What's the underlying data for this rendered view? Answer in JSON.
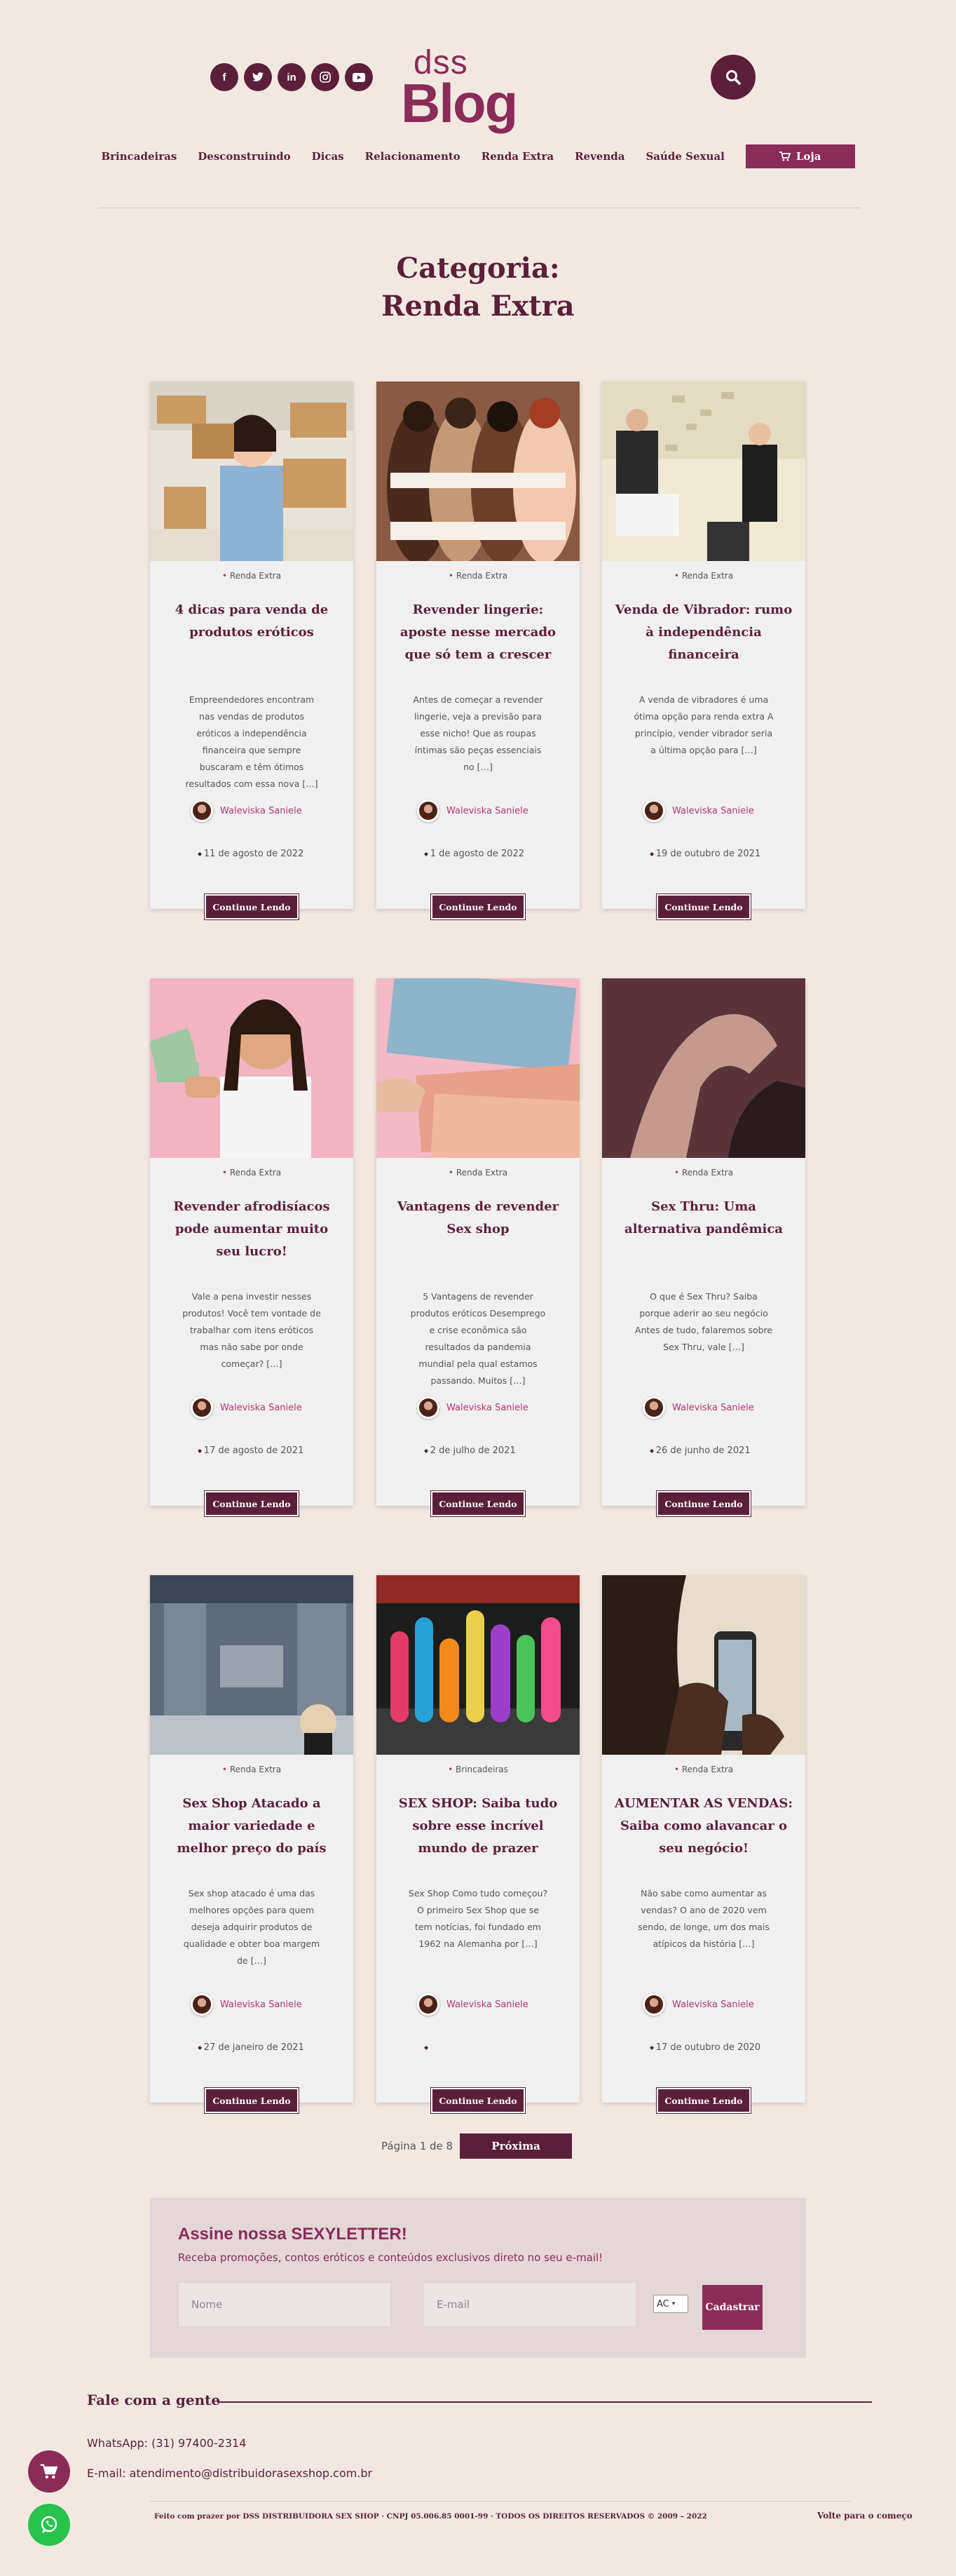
{
  "header": {
    "logo_small": "dss",
    "logo_big": "Blog",
    "socials": [
      "f",
      "t",
      "in",
      "ig",
      "yt"
    ],
    "nav": [
      "Brincadeiras",
      "Desconstruindo",
      "Dicas",
      "Relacionamento",
      "Renda Extra",
      "Revenda",
      "Saúde Sexual"
    ],
    "shop_label": "Loja"
  },
  "category": {
    "line1": "Categoria:",
    "line2": "Renda Extra"
  },
  "cards": [
    {
      "category": "Renda Extra",
      "title": "4 dicas para venda de produtos eróticos",
      "excerpt": "Empreendedores encontram nas vendas de produtos eróticos a independência financeira que sempre buscaram e têm ótimos resultados com essa nova […]",
      "author": "Waleviska Saniele",
      "date": "11 de agosto de 2022",
      "more": "Continue Lendo"
    },
    {
      "category": "Renda Extra",
      "title": "Revender lingerie: aposte nesse mercado que só tem a crescer",
      "excerpt": "Antes de começar a revender lingerie, veja a previsão para esse nicho! Que as roupas íntimas são peças essenciais no […]",
      "author": "Waleviska Saniele",
      "date": "1 de agosto de 2022",
      "more": "Continue Lendo"
    },
    {
      "category": "Renda Extra",
      "title": "Venda de Vibrador: rumo à independência financeira",
      "excerpt": "A venda de vibradores é uma ótima opção para renda extra A princípio, vender vibrador seria a última opção para […]",
      "author": "Waleviska Saniele",
      "date": "19 de outubro de 2021",
      "more": "Continue Lendo"
    },
    {
      "category": "Renda Extra",
      "title": "Revender afrodisíacos pode aumentar muito seu lucro!",
      "excerpt": "Vale a pena investir nesses produtos!  Você tem vontade de trabalhar com itens eróticos mas não sabe por onde começar?  […]",
      "author": "Waleviska Saniele",
      "date": "17 de agosto de 2021",
      "more": "Continue Lendo"
    },
    {
      "category": "Renda Extra",
      "title": "Vantagens de revender Sex shop",
      "excerpt": "5 Vantagens de revender produtos eróticos Desemprego e crise econômica são resultados da pandemia mundial pela qual estamos passando. Muitos […]",
      "author": "Waleviska Saniele",
      "date": "2 de julho de 2021",
      "more": "Continue Lendo"
    },
    {
      "category": "Renda Extra",
      "title": "Sex Thru: Uma alternativa pandêmica",
      "excerpt": "O que é Sex Thru? Saiba porque aderir ao seu negócio Antes de tudo, falaremos sobre Sex Thru, vale […]",
      "author": "Waleviska Saniele",
      "date": "26 de junho de 2021",
      "more": "Continue Lendo"
    },
    {
      "category": "Renda Extra",
      "title": "Sex Shop Atacado a maior variedade e melhor preço do país",
      "excerpt": "Sex shop atacado é uma das melhores opções para quem deseja adquirir produtos de qualidade e obter boa margem de […]",
      "author": "Waleviska Saniele",
      "date": "27 de janeiro de 2021",
      "more": "Continue Lendo"
    },
    {
      "category": "Brincadeiras",
      "title": "SEX SHOP: Saiba tudo sobre esse incrível mundo de prazer",
      "excerpt": "Sex Shop Como tudo começou? O primeiro Sex Shop que se tem notícias, foi fundado em 1962 na Alemanha por […]",
      "author": "Waleviska Saniele",
      "date": "",
      "more": "Continue Lendo"
    },
    {
      "category": "Renda Extra",
      "title": "AUMENTAR AS VENDAS: Saiba como alavancar o seu negócio!",
      "excerpt": "Não sabe como aumentar as vendas? O ano de 2020 vem sendo, de longe, um dos mais atípicos da história […]",
      "author": "Waleviska Saniele",
      "date": "17 de outubro de 2020",
      "more": "Continue Lendo"
    }
  ],
  "pagination": {
    "text": "Página 1 de 8",
    "next": "Próxima"
  },
  "newsletter": {
    "title": "Assine nossa SEXYLETTER!",
    "subtitle": "Receba promoções, contos eróticos e conteúdos exclusivos direto no seu e-mail!",
    "name_placeholder": "Nome",
    "email_placeholder": "E-mail",
    "state": "AC",
    "submit": "Cadastrar"
  },
  "contact": {
    "title": "Fale com a gente",
    "whatsapp": "WhatsApp: (31) 97400-2314",
    "email": "E-mail: atendimento@distribuidorasexshop.com.br"
  },
  "footer": {
    "text": "Feito com prazer por DSS DISTRIBUIDORA SEX SHOP · CNPJ 05.006.85 0001-99 · TODOS OS DIREITOS RESERVADOS © 2009 – 2022",
    "back_top": "Volte para o começo"
  }
}
